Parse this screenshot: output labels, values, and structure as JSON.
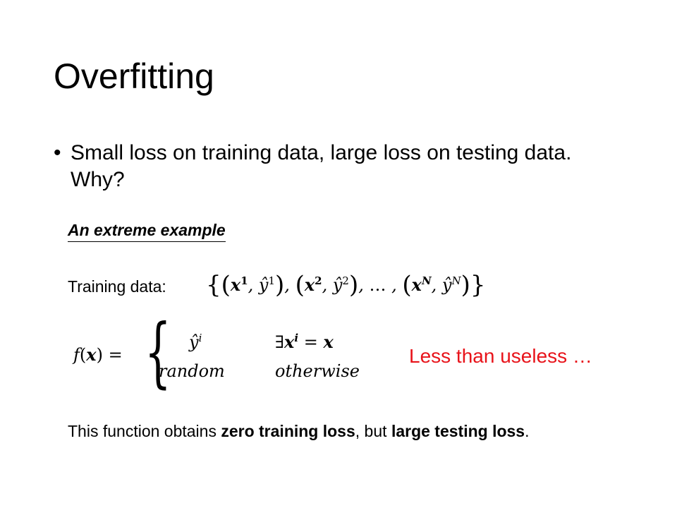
{
  "slide": {
    "title": "Overfitting",
    "bullet": {
      "symbol": "•",
      "text": "Small loss on training data, large loss on testing data. Why?"
    },
    "example_heading": "An extreme example",
    "training_data_label": "Training data:",
    "function_label": "f(x) =",
    "cases": [
      {
        "value": "ŷ^i",
        "condition": "∃x^i = x"
      },
      {
        "value": "random",
        "condition": "otherwise"
      }
    ],
    "remark": "Less than useless …",
    "remark_color": "#e8131a",
    "conclusion": {
      "part1": "This function obtains ",
      "bold1": "zero training loss",
      "part2": ", but ",
      "bold2": "large testing loss",
      "part3": "."
    }
  }
}
